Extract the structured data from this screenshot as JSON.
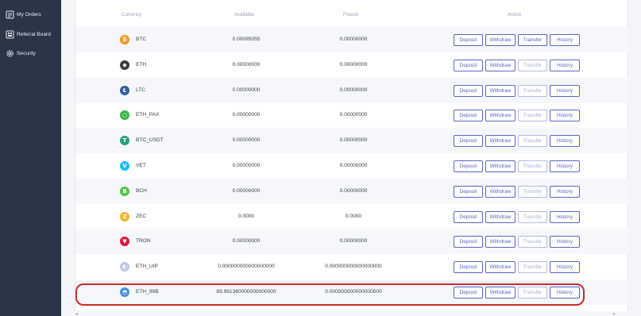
{
  "sidebar": {
    "items": [
      {
        "label": "My Orders",
        "icon": "orders-icon"
      },
      {
        "label": "Referral Board",
        "icon": "referral-icon"
      },
      {
        "label": "Security",
        "icon": "gear-icon"
      }
    ]
  },
  "table": {
    "headers": {
      "currency": "Currency",
      "available": "Available",
      "freeze": "Freeze",
      "action": "Action"
    },
    "buttons": {
      "deposit": "Deposit",
      "withdraw": "Withdraw",
      "transfer": "Transfer",
      "history": "History"
    },
    "rows": [
      {
        "currency": "BTC",
        "available": "0.00095055",
        "freeze": "0.00000000",
        "icon": "btc-icon",
        "icon_color": "#f7931a",
        "transfer_enabled": true
      },
      {
        "currency": "ETH",
        "available": "0.00000000",
        "freeze": "0.00000000",
        "icon": "eth-icon",
        "icon_color": "#3c3c3d",
        "transfer_enabled": false
      },
      {
        "currency": "LTC",
        "available": "0.00000000",
        "freeze": "0.00000000",
        "icon": "ltc-icon",
        "icon_color": "#345d9d",
        "transfer_enabled": false
      },
      {
        "currency": "ETH_PAX",
        "available": "0.00000000",
        "freeze": "0.00000000",
        "icon": "pax-icon",
        "icon_color": "#3bb54a",
        "transfer_enabled": false
      },
      {
        "currency": "BTC_USDT",
        "available": "0.00000000",
        "freeze": "0.00000000",
        "icon": "usdt-icon",
        "icon_color": "#26a17b",
        "transfer_enabled": false
      },
      {
        "currency": "VET",
        "available": "0.00000000",
        "freeze": "0.00000000",
        "icon": "vet-icon",
        "icon_color": "#15bdff",
        "transfer_enabled": false
      },
      {
        "currency": "BCH",
        "available": "0.00000000",
        "freeze": "0.00000000",
        "icon": "bch-icon",
        "icon_color": "#4cc947",
        "transfer_enabled": false
      },
      {
        "currency": "ZEC",
        "available": "0.0000",
        "freeze": "0.0000",
        "icon": "zec-icon",
        "icon_color": "#f4b728",
        "transfer_enabled": false
      },
      {
        "currency": "TRON",
        "available": "0.00000000",
        "freeze": "0.00000000",
        "icon": "tron-icon",
        "icon_color": "#e6163a",
        "transfer_enabled": false
      },
      {
        "currency": "ETH_UIP",
        "available": "0.000000000000000000",
        "freeze": "0.000000000000000000",
        "icon": "uip-icon",
        "icon_color": "#b8c6e8",
        "transfer_enabled": false
      },
      {
        "currency": "ETH_99B",
        "available": "89.991360000000000000",
        "freeze": "0.000000000000000000",
        "icon": "99b-icon",
        "icon_color": "#4a90d9",
        "transfer_enabled": false
      }
    ]
  },
  "colors": {
    "sidebar_bg": "#2b3547",
    "accent": "#5a66c4",
    "highlight": "#cc2b2b"
  }
}
